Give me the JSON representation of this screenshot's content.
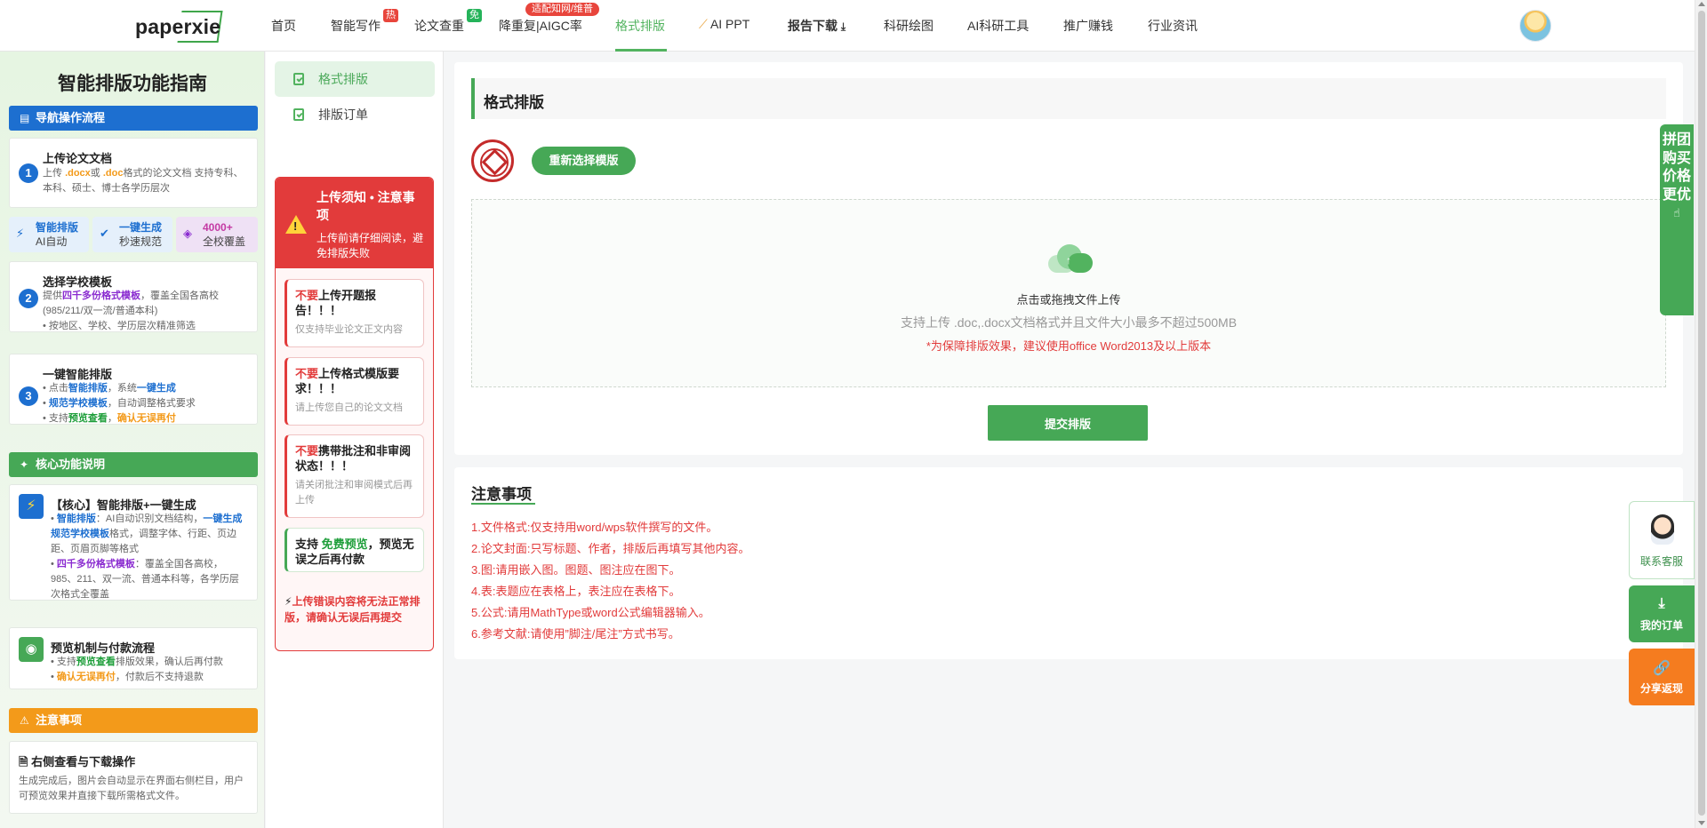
{
  "nav": {
    "logo": "paperxie",
    "items": [
      {
        "label": "首页"
      },
      {
        "label": "智能写作",
        "badge": "热"
      },
      {
        "label": "论文查重",
        "badge": "免"
      },
      {
        "label": "降重复|AIGC率",
        "badge": "适配知网/维普"
      },
      {
        "label": "格式排版"
      },
      {
        "label": "AI PPT",
        "icon": "magic-wand-icon"
      },
      {
        "label": "报告下载",
        "icon": "download-icon"
      },
      {
        "label": "科研绘图"
      },
      {
        "label": "AI科研工具"
      },
      {
        "label": "推广赚钱"
      },
      {
        "label": "行业资讯"
      }
    ],
    "active_color": "#52b35f"
  },
  "guide": {
    "title": "智能排版功能指南",
    "nav_section": "导航操作流程",
    "steps": [
      {
        "num": "1",
        "title": "上传论文文档",
        "text_a": "上传 ",
        "docx": ".docx",
        "text_b": "或 ",
        "doc": ".doc",
        "text_c": "格式的论文文档 支持专科、本科、硕士、博士各学历层次"
      },
      {
        "num": "2",
        "title": "选择学校模板",
        "text_a": "提供",
        "hl": "四千多份格式模板",
        "text_b": "，覆盖全国各高校(985/211/双一流/普通本科)",
        "bullet": "• 按地区、学校、学历层次精准筛选"
      },
      {
        "num": "3",
        "title": "一键智能排版",
        "b1a": "• 点击",
        "b1hl": "智能排版",
        "b1b": "，系统",
        "b1hl2": "一键生成",
        "b2hl": "规范学校模板",
        "b2b": "，自动调整格式要求",
        "b3a": "• 支持",
        "b3hl": "预览查看",
        "b3b": "，",
        "b3hl2": "确认无误再付"
      }
    ],
    "chips": [
      {
        "t1": "智能排版",
        "t2": "AI自动",
        "icon": "lightning-icon"
      },
      {
        "t1": "一键生成",
        "t2": "秒速规范",
        "icon": "check-circle-icon"
      },
      {
        "t1": "4000+",
        "t2": "全校覆盖",
        "icon": "layers-icon"
      }
    ],
    "core_section": "核心功能说明",
    "core": {
      "title": "【核心】智能排版+一键生成",
      "b1a": "• ",
      "b1hl": "智能排版",
      "b1b": "：AI自动识别文档结构，",
      "b1hl2": "一键生成规范学校模板",
      "b1c": "格式，调整字体、行距、页边距、页眉页脚等格式",
      "b2a": "• ",
      "b2hl": "四千多份格式模板",
      "b2b": "：覆盖全国各高校，985、211、双一流、普通本科等，各学历层次格式全覆盖"
    },
    "preview": {
      "title": "预览机制与付款流程",
      "b1a": "• 支持",
      "b1hl": "预览查看",
      "b1b": "排版效果，确认后再付款",
      "b2a": "• ",
      "b2hl": "确认无误再付",
      "b2b": "，付款后不支持退款"
    },
    "attention_section": "注意事项",
    "download": {
      "title": "右侧查看与下载操作",
      "text": "生成完成后，图片会自动显示在界面右侧栏目，用户可预览效果并直接下载所需格式文件。"
    }
  },
  "menu": {
    "items": [
      {
        "label": "格式排版"
      },
      {
        "label": "排版订单"
      }
    ]
  },
  "notice": {
    "title": "上传须知 • 注意事项",
    "subtitle": "上传前请仔细阅读，避免排版失败",
    "cards": [
      {
        "neg": "不要",
        "rest": "上传开题报告！！！",
        "sub": "仅支持毕业论文正文内容"
      },
      {
        "neg": "不要",
        "rest": "上传格式模版要求！！！",
        "sub": "请上传您自己的论文文档"
      },
      {
        "neg": "不要",
        "rest": "携带批注和非审阅状态！！！",
        "sub": "请关闭批注和审阅模式后再上传"
      }
    ],
    "pay": {
      "a": "支持 ",
      "hl": "免费预览",
      "b": "，预览无误之后再付款"
    },
    "footer": "上传错误内容将无法正常排版，请确认无误后再提交"
  },
  "main": {
    "title": "格式排版",
    "reselect_label": "重新选择模版",
    "dropzone": {
      "line1": "点击或拖拽文件上传",
      "line2": "支持上传 .doc,.docx文档格式并且文件大小最多不超过500MB",
      "line3": "*为保障排版效果，建议使用office Word2013及以上版本"
    },
    "submit_label": "提交排版",
    "accent": "#46a856"
  },
  "notes": {
    "title": "注意事项",
    "items": [
      "1.文件格式:仅支持用word/wps软件撰写的文件。",
      "2.论文封面:只写标题、作者，排版后再填写其他内容。",
      "3.图:请用嵌入图。图题、图注应在图下。",
      "4.表:表题应在表格上，表注应在表格下。",
      "5.公式:请用MathType或word公式编辑器输入。",
      "6.参考文献:请使用”脚注/尾注”方式书写。"
    ]
  },
  "floating": {
    "group_buy": "拼团购买 价格更优",
    "customer_service": "联系客服",
    "my_orders": "我的订单",
    "share": "分享返现"
  }
}
